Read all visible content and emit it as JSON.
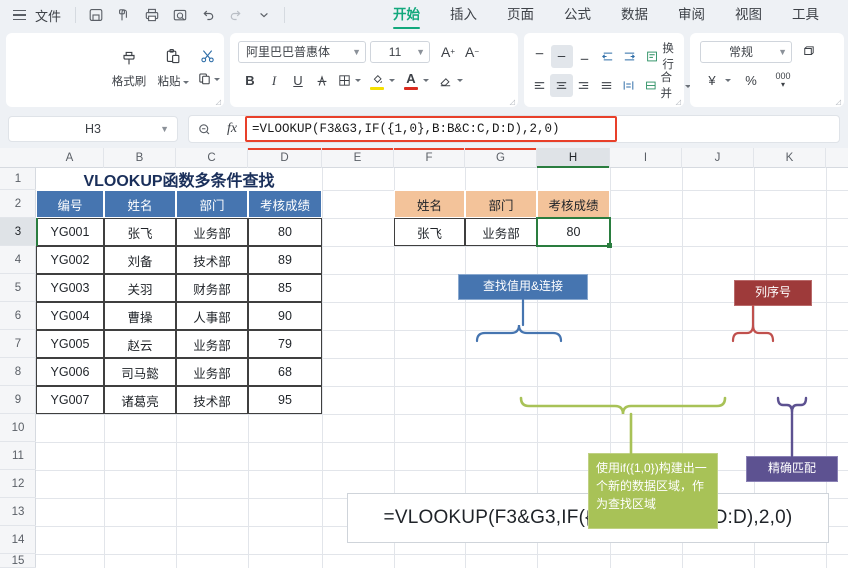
{
  "app": {
    "file_menu": "文件",
    "quick_icons": [
      "save-icon",
      "save-as-icon",
      "print-icon",
      "print-preview-icon",
      "undo-icon",
      "redo-icon",
      "customize-caret-icon"
    ],
    "tabs": [
      {
        "label": "开始",
        "active": true
      },
      {
        "label": "插入",
        "active": false
      },
      {
        "label": "页面",
        "active": false
      },
      {
        "label": "公式",
        "active": false
      },
      {
        "label": "数据",
        "active": false
      },
      {
        "label": "审阅",
        "active": false
      },
      {
        "label": "视图",
        "active": false
      },
      {
        "label": "工具",
        "active": false
      }
    ],
    "accent_color": "#12a87c",
    "highlight_red": "#e8402a"
  },
  "ribbon": {
    "clipboard": {
      "format_painter": "格式刷",
      "paste": "粘贴",
      "copy": ""
    },
    "font": {
      "family": "阿里巴巴普惠体",
      "size": "11",
      "grow": "A+",
      "shrink": "A-",
      "bold": "B",
      "italic": "I",
      "underline": "U",
      "strikethrough": "A",
      "borders": "borders-icon",
      "fill_color": "#f5e000",
      "font_color": "#d92b1f",
      "clear_format": "eraser-icon"
    },
    "alignment": {
      "wrap": "换行",
      "merge": "合并"
    },
    "number": {
      "format": "常规",
      "currency": "¥",
      "percent": "%",
      "thousands": "000"
    }
  },
  "formula_bar": {
    "name_box": "H3",
    "formula": "=VLOOKUP(F3&G3,IF({1,0},B:B&C:C,D:D),2,0)",
    "zoom_icon": "zoom-out-icon",
    "fx_label": "fx"
  },
  "sheet": {
    "columns": [
      "A",
      "B",
      "C",
      "D",
      "E",
      "F",
      "G",
      "H",
      "I",
      "J",
      "K"
    ],
    "selected_column": "H",
    "rows": [
      "1",
      "2",
      "3",
      "4",
      "5",
      "6",
      "7",
      "8",
      "9",
      "10",
      "11",
      "12",
      "13",
      "14",
      "15"
    ],
    "selected_row": "3",
    "title": "VLOOKUP函数多条件查找",
    "table": {
      "headers": [
        "编号",
        "姓名",
        "部门",
        "考核成绩"
      ],
      "rows": [
        [
          "YG001",
          "张飞",
          "业务部",
          "80"
        ],
        [
          "YG002",
          "刘备",
          "技术部",
          "89"
        ],
        [
          "YG003",
          "关羽",
          "财务部",
          "85"
        ],
        [
          "YG004",
          "曹操",
          "人事部",
          "90"
        ],
        [
          "YG005",
          "赵云",
          "业务部",
          "79"
        ],
        [
          "YG006",
          "司马懿",
          "业务部",
          "68"
        ],
        [
          "YG007",
          "诸葛亮",
          "技术部",
          "95"
        ]
      ]
    },
    "lookup_table": {
      "headers": [
        "姓名",
        "部门",
        "考核成绩"
      ],
      "row": [
        "张飞",
        "业务部",
        "80"
      ],
      "header_color": "#f3c39a",
      "result_cell": "80"
    },
    "formula_box": "=VLOOKUP(F3&G3,IF({1,0},B:B&C:C,D:D),2,0)",
    "callouts": [
      {
        "text": "查找值用&连接",
        "color": "#4675b0",
        "name": "callout-lookup-value"
      },
      {
        "text": "列序号",
        "color": "#9e3a3a",
        "name": "callout-column-index"
      },
      {
        "text": "精确匹配",
        "color": "#5d5291",
        "name": "callout-exact-match"
      },
      {
        "text": "使用if({1,0})构建出一个新的数据区域，作为查找区域",
        "color": "#a8c257",
        "name": "callout-if-array"
      }
    ]
  }
}
